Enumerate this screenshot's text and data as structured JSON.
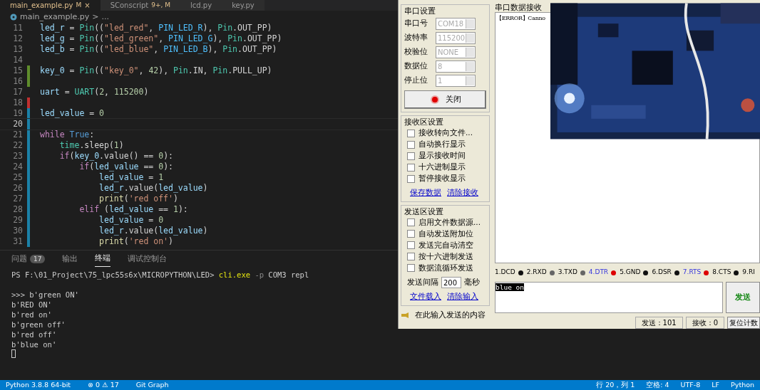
{
  "editor": {
    "tabs": [
      {
        "label": "main_example.py",
        "badge": "M",
        "selected": true,
        "close": "×"
      },
      {
        "label": "SConscript",
        "badge": "9+, M",
        "selected": false
      },
      {
        "label": "lcd.py",
        "selected": false
      },
      {
        "label": "key.py",
        "selected": false
      }
    ],
    "breadcrumb": [
      "main_example.py",
      ">",
      "..."
    ],
    "lines": [
      {
        "number": "11",
        "current": false,
        "tokens": [
          {
            "text": "led_r",
            "kind": "var"
          },
          {
            "text": " = ",
            "kind": "op"
          },
          {
            "text": "Pin",
            "kind": "class"
          },
          {
            "text": "((",
            "kind": "op"
          },
          {
            "text": "\"led_red\"",
            "kind": "str"
          },
          {
            "text": ", ",
            "kind": "op"
          },
          {
            "text": "PIN_LED_R",
            "kind": "const"
          },
          {
            "text": "), ",
            "kind": "op"
          },
          {
            "text": "Pin",
            "kind": "class"
          },
          {
            "text": ".OUT_PP)",
            "kind": "op"
          }
        ]
      },
      {
        "number": "12",
        "current": false,
        "tokens": [
          {
            "text": "led_g",
            "kind": "var"
          },
          {
            "text": " = ",
            "kind": "op"
          },
          {
            "text": "Pin",
            "kind": "class"
          },
          {
            "text": "((",
            "kind": "op"
          },
          {
            "text": "\"led_green\"",
            "kind": "str"
          },
          {
            "text": ", ",
            "kind": "op"
          },
          {
            "text": "PIN_LED_G",
            "kind": "const"
          },
          {
            "text": "), ",
            "kind": "op"
          },
          {
            "text": "Pin",
            "kind": "class"
          },
          {
            "text": ".OUT_PP)",
            "kind": "op"
          }
        ]
      },
      {
        "number": "13",
        "current": false,
        "tokens": [
          {
            "text": "led_b",
            "kind": "var"
          },
          {
            "text": " = ",
            "kind": "op"
          },
          {
            "text": "Pin",
            "kind": "class"
          },
          {
            "text": "((",
            "kind": "op"
          },
          {
            "text": "\"led_blue\"",
            "kind": "str"
          },
          {
            "text": ", ",
            "kind": "op"
          },
          {
            "text": "PIN_LED_B",
            "kind": "const"
          },
          {
            "text": "), ",
            "kind": "op"
          },
          {
            "text": "Pin",
            "kind": "class"
          },
          {
            "text": ".OUT_PP)",
            "kind": "op"
          }
        ]
      },
      {
        "number": "14",
        "current": false
      },
      {
        "number": "15",
        "current": false,
        "color": "#5f8d2c",
        "tokens": [
          {
            "text": "key_0",
            "kind": "var"
          },
          {
            "text": " = ",
            "kind": "op"
          },
          {
            "text": "Pin",
            "kind": "class"
          },
          {
            "text": "((",
            "kind": "op"
          },
          {
            "text": "\"key_0\"",
            "kind": "str"
          },
          {
            "text": ", ",
            "kind": "op"
          },
          {
            "text": "42",
            "kind": "num"
          },
          {
            "text": "), ",
            "kind": "op"
          },
          {
            "text": "Pin",
            "kind": "class"
          },
          {
            "text": ".IN, ",
            "kind": "op"
          },
          {
            "text": "Pin",
            "kind": "class"
          },
          {
            "text": ".PULL_UP)",
            "kind": "op"
          }
        ]
      },
      {
        "number": "16",
        "current": false,
        "color": "#5f8d2c"
      },
      {
        "number": "17",
        "current": false,
        "tokens": [
          {
            "text": "uart",
            "kind": "var"
          },
          {
            "text": " = ",
            "kind": "op"
          },
          {
            "text": "UART",
            "kind": "class"
          },
          {
            "text": "(",
            "kind": "op"
          },
          {
            "text": "2",
            "kind": "num"
          },
          {
            "text": ", ",
            "kind": "op"
          },
          {
            "text": "115200",
            "kind": "num"
          },
          {
            "text": ")",
            "kind": "op"
          }
        ]
      },
      {
        "number": "18",
        "current": false,
        "color": "#c03030"
      },
      {
        "number": "19",
        "current": false,
        "color": "#1b81a8",
        "tokens": [
          {
            "text": "led_value",
            "kind": "var"
          },
          {
            "text": " = ",
            "kind": "op"
          },
          {
            "text": "0",
            "kind": "num"
          }
        ]
      },
      {
        "number": "20",
        "current": true,
        "color": "#1b81a8"
      },
      {
        "number": "21",
        "current": false,
        "color": "#1b81a8",
        "tokens": [
          {
            "text": "while ",
            "kind": "kw"
          },
          {
            "text": "True",
            "kind": "bool"
          },
          {
            "text": ":",
            "kind": "op"
          }
        ]
      },
      {
        "number": "22",
        "current": false,
        "color": "#1b81a8",
        "tokens": [
          {
            "text": "    time",
            "kind": "class"
          },
          {
            "text": ".sleep(",
            "kind": "op"
          },
          {
            "text": "1",
            "kind": "num"
          },
          {
            "text": ")",
            "kind": "op"
          }
        ]
      },
      {
        "number": "23",
        "current": false,
        "color": "#1b81a8",
        "tokens": [
          {
            "text": "    if",
            "kind": "kw"
          },
          {
            "text": "(",
            "kind": "op"
          },
          {
            "text": "key_0",
            "kind": "var"
          },
          {
            "text": ".value() == ",
            "kind": "op"
          },
          {
            "text": "0",
            "kind": "num"
          },
          {
            "text": "):",
            "kind": "op"
          }
        ]
      },
      {
        "number": "24",
        "current": false,
        "color": "#1b81a8",
        "tokens": [
          {
            "text": "        if",
            "kind": "kw"
          },
          {
            "text": "(",
            "kind": "op"
          },
          {
            "text": "led_value",
            "kind": "var"
          },
          {
            "text": " == ",
            "kind": "op"
          },
          {
            "text": "0",
            "kind": "num"
          },
          {
            "text": "):",
            "kind": "op"
          }
        ]
      },
      {
        "number": "25",
        "current": false,
        "color": "#1b81a8",
        "tokens": [
          {
            "text": "            led_value",
            "kind": "var"
          },
          {
            "text": " = ",
            "kind": "op"
          },
          {
            "text": "1",
            "kind": "num"
          }
        ]
      },
      {
        "number": "26",
        "current": false,
        "color": "#1b81a8",
        "tokens": [
          {
            "text": "            led_r",
            "kind": "var"
          },
          {
            "text": ".value(",
            "kind": "op"
          },
          {
            "text": "led_value",
            "kind": "var"
          },
          {
            "text": ")",
            "kind": "op"
          }
        ]
      },
      {
        "number": "27",
        "current": false,
        "color": "#1b81a8",
        "tokens": [
          {
            "text": "            print",
            "kind": "fn"
          },
          {
            "text": "(",
            "kind": "op"
          },
          {
            "text": "'red off'",
            "kind": "str"
          },
          {
            "text": ")",
            "kind": "op"
          }
        ]
      },
      {
        "number": "28",
        "current": false,
        "color": "#1b81a8",
        "tokens": [
          {
            "text": "        elif",
            "kind": "kw"
          },
          {
            "text": " (",
            "kind": "op"
          },
          {
            "text": "led_value",
            "kind": "var"
          },
          {
            "text": " == ",
            "kind": "op"
          },
          {
            "text": "1",
            "kind": "num"
          },
          {
            "text": "):",
            "kind": "op"
          }
        ]
      },
      {
        "number": "29",
        "current": false,
        "color": "#1b81a8",
        "tokens": [
          {
            "text": "            led_value",
            "kind": "var"
          },
          {
            "text": " = ",
            "kind": "op"
          },
          {
            "text": "0",
            "kind": "num"
          }
        ]
      },
      {
        "number": "30",
        "current": false,
        "color": "#1b81a8",
        "tokens": [
          {
            "text": "            led_r",
            "kind": "var"
          },
          {
            "text": ".value(",
            "kind": "op"
          },
          {
            "text": "led_value",
            "kind": "var"
          },
          {
            "text": ")",
            "kind": "op"
          }
        ]
      },
      {
        "number": "31",
        "current": false,
        "color": "#1b81a8",
        "tokens": [
          {
            "text": "            print",
            "kind": "fn"
          },
          {
            "text": "(",
            "kind": "op"
          },
          {
            "text": "'red on'",
            "kind": "str"
          },
          {
            "text": ")",
            "kind": "op"
          }
        ]
      }
    ]
  },
  "panel": {
    "tabs": [
      {
        "label": "问题",
        "count": "17",
        "selected": false
      },
      {
        "label": "输出",
        "selected": false
      },
      {
        "label": "终端",
        "selected": true
      },
      {
        "label": "调试控制台",
        "selected": false
      }
    ],
    "prompt": [
      {
        "text": "PS F:\\01_Project\\75_lpc55s6x\\MICROPYTHON\\LED> ",
        "kind": "plain"
      },
      {
        "text": "cli.exe",
        "kind": "cmd"
      },
      {
        "text": " -p",
        "kind": "flag"
      },
      {
        "text": " COM3 repl",
        "kind": "plain"
      }
    ],
    "output": [
      ">>> b'green ON'",
      "b'RED ON'",
      "b'red on'",
      "b'green off'",
      "b'red off'",
      "b'blue on'"
    ]
  },
  "serial": {
    "port_group": {
      "title": "串口设置",
      "settings": [
        {
          "label": "串口号",
          "value": "COM18",
          "disabled": true
        },
        {
          "label": "波特率",
          "value": "115200",
          "disabled": true
        },
        {
          "label": "校验位",
          "value": "NONE",
          "disabled": true
        },
        {
          "label": "数据位",
          "value": "8",
          "disabled": true
        },
        {
          "label": "停止位",
          "value": "1",
          "disabled": true
        }
      ],
      "button": {
        "label": "关闭",
        "on": true
      }
    },
    "receive_group": {
      "title": "接收区设置",
      "options": [
        {
          "label": "接收转向文件...",
          "checked": false
        },
        {
          "label": "自动换行显示",
          "checked": false
        },
        {
          "label": "显示接收时间",
          "checked": false
        },
        {
          "label": "十六进制显示",
          "checked": false
        },
        {
          "label": "暂停接收显示",
          "checked": false
        }
      ],
      "links": [
        "保存数据",
        "清除接收"
      ]
    },
    "send_group": {
      "title": "发送区设置",
      "options": [
        {
          "label": "启用文件数据源...",
          "checked": false
        },
        {
          "label": "自动发送附加位",
          "checked": false
        },
        {
          "label": "发送完自动清空",
          "checked": false
        },
        {
          "label": "按十六进制发送",
          "checked": false
        },
        {
          "label": "数据流循环发送",
          "checked": false
        }
      ],
      "interval_label": "发送间隔",
      "interval": "200",
      "interval_unit": "毫秒",
      "links": [
        "文件载入",
        "清除输入"
      ]
    },
    "hint": "在此输入发送的内容",
    "receive_title": "串口数据接收",
    "received": "【ERROR】Canno",
    "signals": [
      {
        "label": "1.DCD",
        "active": false,
        "color": "#111111"
      },
      {
        "label": "2.RXD",
        "active": false,
        "color": "#666666"
      },
      {
        "label": "3.TXD",
        "active": false,
        "color": "#666666"
      },
      {
        "label": "4.DTR",
        "active": true,
        "color": "#dd0000"
      },
      {
        "label": "5.GND",
        "active": false,
        "color": "#111111"
      },
      {
        "label": "6.DSR",
        "active": false,
        "color": "#111111"
      },
      {
        "label": "7.RTS",
        "active": true,
        "color": "#dd0000"
      },
      {
        "label": "8.CTS",
        "active": false,
        "color": "#111111"
      },
      {
        "label": "9.RI",
        "active": false
      }
    ],
    "send_text": "blue on",
    "send_button": "发送",
    "sent": "发送：101",
    "received_count": "接收：0",
    "reset_button": "复位计数"
  },
  "status_bar": {
    "left": [
      "Python 3.8.8 64-bit",
      "⊗ 0 ⚠ 17",
      "Git Graph"
    ],
    "right": [
      "行 20，列 1",
      "空格: 4",
      "UTF-8",
      "LF",
      "Python"
    ]
  }
}
